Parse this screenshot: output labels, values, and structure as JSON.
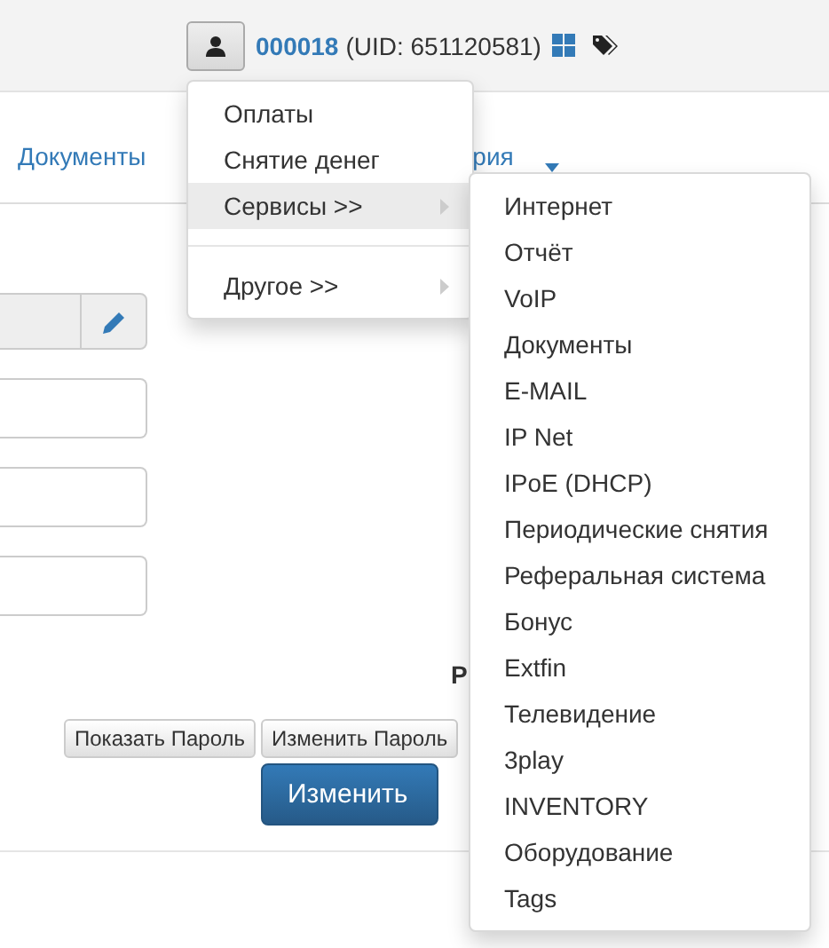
{
  "header": {
    "user_link": "000018",
    "uid_text": "(UID: 651120581)"
  },
  "tabs": [
    {
      "label": "Документы",
      "kind": "tab"
    },
    {
      "label": "рия",
      "kind": "tab"
    },
    {
      "kind": "caret"
    }
  ],
  "form": {
    "partial_label": "Р",
    "buttons": [
      {
        "label": "Показать Пароль",
        "kind": "default"
      },
      {
        "label": "Изменить Пароль",
        "kind": "default"
      },
      {
        "label": "Изменить",
        "kind": "primary"
      }
    ]
  },
  "menu": {
    "items": [
      {
        "label": "Оплаты",
        "kind": "item",
        "highlighted": false
      },
      {
        "label": "Снятие денег",
        "kind": "item",
        "highlighted": false
      },
      {
        "label": "Сервисы >>",
        "kind": "submenu",
        "highlighted": true
      },
      {
        "kind": "divider"
      },
      {
        "label": "Другое >>",
        "kind": "submenu",
        "highlighted": false
      }
    ],
    "submenu": [
      "Интернет",
      "Отчёт",
      "VoIP",
      "Документы",
      "E-MAIL",
      "IP Net",
      "IPoE (DHCP)",
      "Периодические снятия",
      "Реферальная система",
      "Бонус",
      "Extfin",
      "Телевидение",
      "3play",
      "INVENTORY",
      "Оборудование",
      "Tags"
    ]
  }
}
